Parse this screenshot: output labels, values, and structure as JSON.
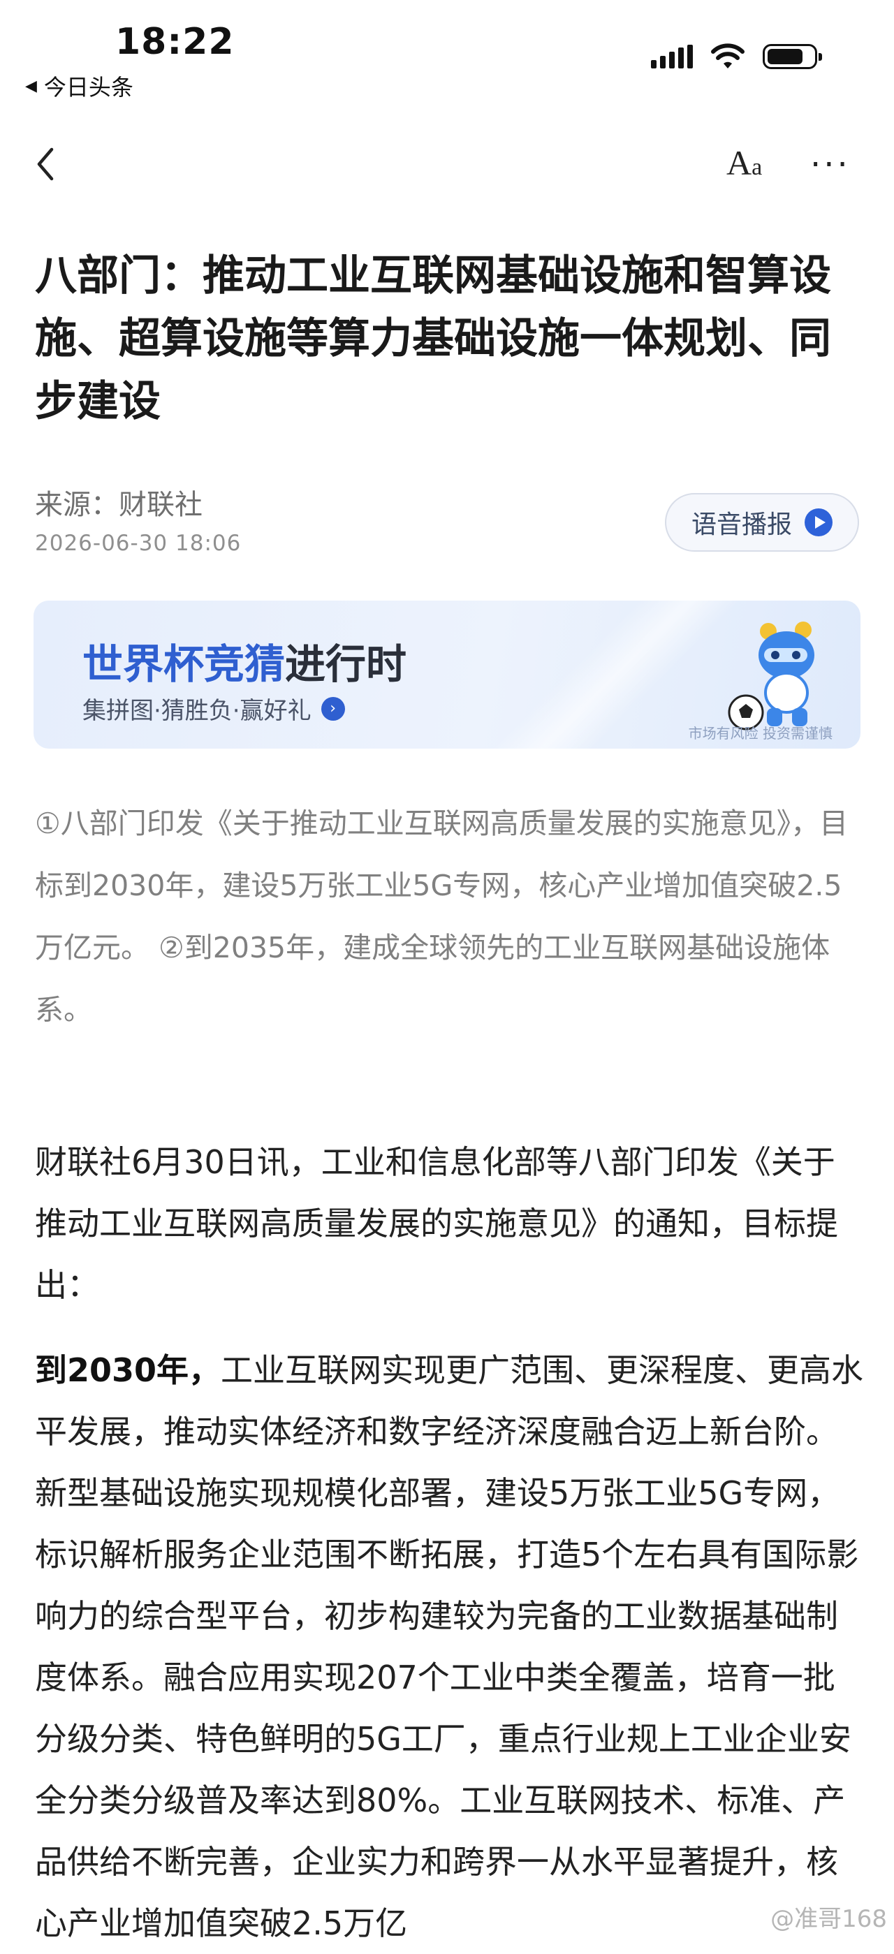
{
  "status_bar": {
    "time": "18:22",
    "back_app": "今日头条",
    "icons": [
      "signal-icon",
      "wifi-icon",
      "battery-icon"
    ]
  },
  "nav": {
    "back_icon": "back-arrow-icon",
    "font_size_label_big": "A",
    "font_size_label_small": "a",
    "more_label": "···"
  },
  "article": {
    "title": "八部门：推动工业互联网基础设施和智算设施、超算设施等算力基础设施一体规划、同步建设",
    "source": "来源：财联社",
    "date": "2026-06-30 18:06",
    "tts_label": "语音播报",
    "summary": "①八部门印发《关于推动工业互联网高质量发展的实施意见》，目标到2030年，建设5万张工业5G专网，核心产业增加值突破2.5万亿元。 ②到2035年，建成全球领先的工业互联网基础设施体系。",
    "paragraph1": "财联社6月30日讯，工业和信息化部等八部门印发《关于推动工业互联网高质量发展的实施意见》的通知，目标提出：",
    "paragraph2_lead": "到2030年，",
    "paragraph2_body": "工业互联网实现更广范围、更深程度、更高水平发展，推动实体经济和数字经济深度融合迈上新台阶。新型基础设施实现规模化部署，建设5万张工业5G专网，标识解析服务企业范围不断拓展，打造5个左右具有国际影响力的综合型平台，初步构建较为完备的工业数据基础制度体系。融合应用实现207个工业中类全覆盖，培育一批分级分类、特色鲜明的5G工厂，重点行业规上工业企业安全分类分级普及率达到80%。工业互联网技术、标准、产品供给不断完善，企业实力和跨界一从水平显著提升，核心产业增加值突破2.5万亿"
  },
  "banner": {
    "title_blue": "世界杯竞猜",
    "title_dark": "进行时",
    "subtitle": "集拼图·猜胜负·赢好礼",
    "disclaimer": "市场有风险 投资需谨慎"
  },
  "watermark": "@准哥168",
  "colors": {
    "accent_blue": "#2f5fd0",
    "text_primary": "#1b1b1b",
    "text_muted": "#808080"
  }
}
